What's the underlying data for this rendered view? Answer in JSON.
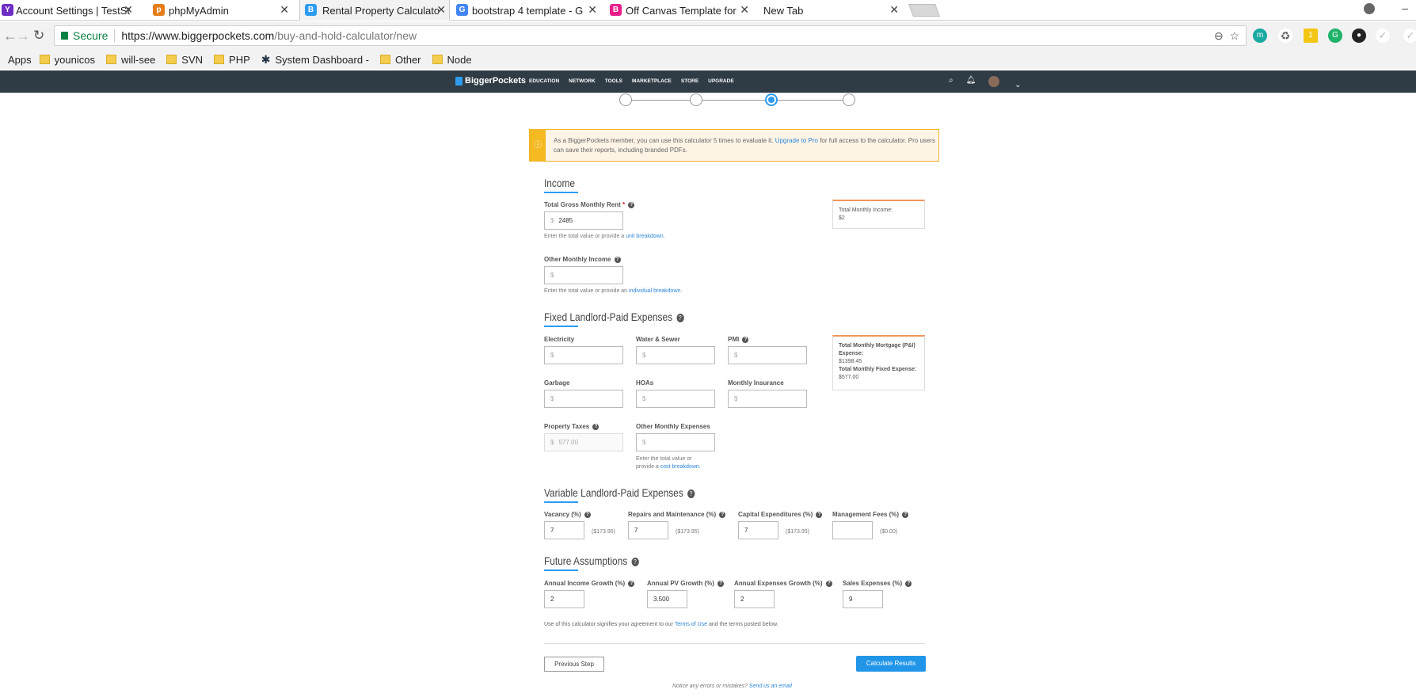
{
  "browser": {
    "tabs": [
      {
        "label": "Account Settings | TestSt",
        "icon": "yahoo-icon",
        "color": "#6e2dc4"
      },
      {
        "label": "phpMyAdmin",
        "icon": "phpmyadmin-icon",
        "color": "#e57e1a"
      },
      {
        "label": "Rental Property Calculato",
        "icon": "biggerpockets-icon",
        "color": "#2d9cf0"
      },
      {
        "label": "bootstrap 4 template - G",
        "icon": "google-icon",
        "color": "#4285f4"
      },
      {
        "label": "Off Canvas Template for",
        "icon": "off-canvas-icon",
        "color": "#e91e8c"
      },
      {
        "label": "New Tab",
        "icon": "",
        "color": ""
      }
    ],
    "secure_label": "Secure",
    "url_host": "https://www.biggerpockets.com",
    "url_path": "/buy-and-hold-calculator/new",
    "bookmarks": [
      "Apps",
      "younicos",
      "will-see",
      "SVN",
      "PHP",
      "System Dashboard -",
      "Other",
      "Node"
    ]
  },
  "site": {
    "logo": "BiggerPockets",
    "menu": [
      "EDUCATION",
      "NETWORK",
      "TOOLS",
      "MARKETPLACE",
      "STORE",
      "UPGRADE"
    ]
  },
  "alert": {
    "text_before": "As a BiggerPockets member, you can use this calculator 5 times to evaluate it. ",
    "link": "Upgrade to Pro",
    "text_after": " for full access to the calculator. Pro users can save their reports, including branded PDFs."
  },
  "income": {
    "title": "Income",
    "gross_rent_label": "Total Gross Monthly Rent",
    "req": "*",
    "gross_rent_value": "2485",
    "gross_help_before": "Enter the total value or provide a ",
    "gross_help_link": "unit breakdown",
    "gross_help_after": ".",
    "other_label": "Other Monthly Income",
    "other_help_before": "Enter the total value or provide an ",
    "other_help_link": "individual breakdown",
    "other_help_after": ".",
    "summary_label": "Total Monthly Income:",
    "summary_value": "$2"
  },
  "fixed": {
    "title": "Fixed Landlord-Paid Expenses",
    "electricity": "Electricity",
    "water": "Water & Sewer",
    "pmi": "PMI",
    "garbage": "Garbage",
    "hoas": "HOAs",
    "insurance": "Monthly Insurance",
    "taxes": "Property Taxes",
    "taxes_value": "577.00",
    "other": "Other Monthly Expenses",
    "other_help_1": "Enter the total value or",
    "other_help_2_before": "provide a ",
    "other_help_link": "cost breakdown",
    "other_help_after": ".",
    "summary_mortgage_label": "Total Monthly Mortgage (P&I) Expense:",
    "summary_mortgage_value": "$1398.45",
    "summary_fixed_label": "Total Monthly Fixed Expense:",
    "summary_fixed_value": "$577.00"
  },
  "variable": {
    "title": "Variable Landlord-Paid Expenses",
    "vacancy": "Vacancy (%)",
    "vacancy_value": "7",
    "vacancy_amt": "($173.95)",
    "repairs": "Repairs and Maintenance (%)",
    "repairs_value": "7",
    "repairs_amt": "($173.95)",
    "capex": "Capital Expenditures (%)",
    "capex_value": "7",
    "capex_amt": "($173.95)",
    "mgmt": "Management Fees (%)",
    "mgmt_amt": "($0.00)"
  },
  "future": {
    "title": "Future Assumptions",
    "income_growth": "Annual Income Growth (%)",
    "income_growth_value": "2",
    "pv_growth": "Annual PV Growth (%)",
    "pv_growth_value": "3.500",
    "expenses_growth": "Annual Expenses Growth (%)",
    "expenses_growth_value": "2",
    "sales": "Sales Expenses (%)",
    "sales_value": "9"
  },
  "footer": {
    "terms_before": "Use of this calculator signifies your agreement to our ",
    "terms_link": "Terms of Use",
    "terms_after": " and the terms posted below.",
    "prev": "Previous Step",
    "calc": "Calculate Results",
    "notice_before": "Notice any errors or mistakes? ",
    "notice_link": "Send us an email"
  },
  "placeholder": "$"
}
